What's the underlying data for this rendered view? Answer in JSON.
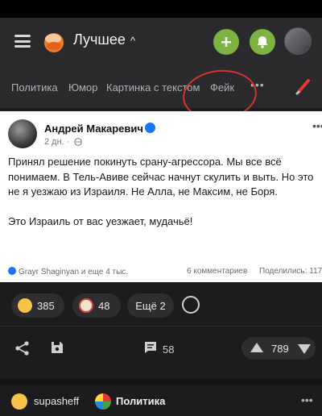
{
  "header": {
    "feed_title": "Лучшее",
    "chevron": "^",
    "icons": [
      "menu-icon",
      "logo-icon",
      "plus-icon",
      "bell-icon",
      "avatar"
    ]
  },
  "tabs": {
    "items": [
      "Политика",
      "Юмор",
      "Картинка с текстом",
      "Фейк"
    ],
    "more": "•••"
  },
  "post": {
    "author": "Андрей Макаревич",
    "time": "2 дн. ·",
    "dots": "•••",
    "body": [
      "Принял решение покинуть срану-агрессора. Мы все всё понимаем. В Тель-Авиве сейчас начнут скулить и выть. Но это не я уезжаю из Израиля. Не Алла, не Максим, не Боря.",
      "Это Израиль от вас уезжает, мудачьё!"
    ],
    "reactions_text": "Grayr Shaginyan и еще 4 тыс.",
    "comments_text": "6 комментариев",
    "shares_text": "Поделились: 117"
  },
  "reactions": {
    "laugh_count": "385",
    "clown_count": "48",
    "more_label": "Ещё 2"
  },
  "actions": {
    "comment_count": "58",
    "rating": "789"
  },
  "footer": {
    "username": "supasheff",
    "community": "Политика",
    "dots": "•••"
  },
  "colors": {
    "background": "#1c1c1e",
    "bar": "#2a2a2c",
    "accent_green": "#7cb342",
    "annotation_red": "#d8322c",
    "verified_blue": "#1877f2"
  }
}
